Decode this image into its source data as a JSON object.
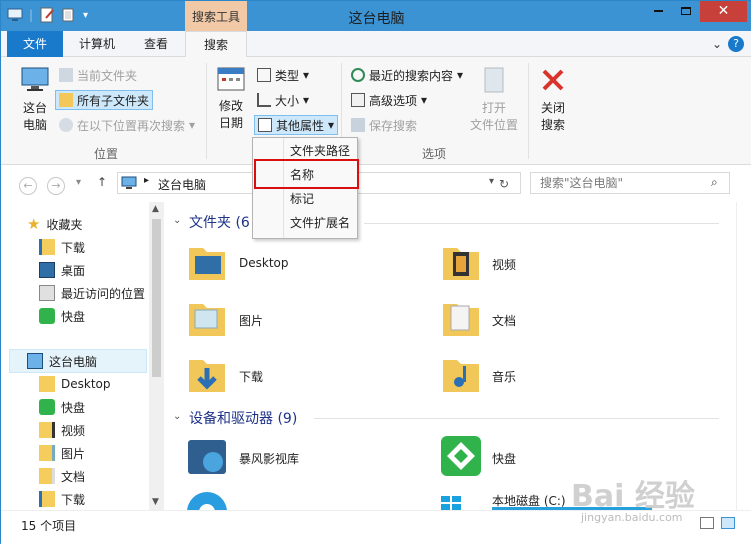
{
  "window": {
    "title": "这台电脑",
    "context_tab": "搜索工具",
    "close_icon": "close-icon"
  },
  "tabs": {
    "file": "文件",
    "computer": "计算机",
    "view": "查看",
    "search": "搜索"
  },
  "ribbon": {
    "this_pc": "这台\n电脑",
    "current_folder": "当前文件夹",
    "all_subfolders": "所有子文件夹",
    "search_again": "在以下位置再次搜索",
    "group_location": "位置",
    "modified_date": "修改\n日期",
    "kind": "类型",
    "size": "大小",
    "other_props": "其他属性",
    "recent_searches": "最近的搜索内容",
    "advanced_options": "高级选项",
    "save_search": "保存搜索",
    "open_location": "打开\n文件位置",
    "group_options": "选项",
    "close_search": "关闭\n搜索"
  },
  "dropdown": {
    "items": [
      "文件夹路径",
      "名称",
      "标记",
      "文件扩展名"
    ]
  },
  "address": {
    "location": "这台电脑",
    "search_placeholder": "搜索\"这台电脑\""
  },
  "sidebar": {
    "favorites": "收藏夹",
    "fav_items": [
      "下载",
      "桌面",
      "最近访问的位置",
      "快盘"
    ],
    "this_pc": "这台电脑",
    "pc_items": [
      "Desktop",
      "快盘",
      "视频",
      "图片",
      "文档",
      "下载"
    ]
  },
  "content": {
    "folders_header": "文件夹 (6",
    "folders": [
      "Desktop",
      "视频",
      "图片",
      "文档",
      "下载",
      "音乐"
    ],
    "devices_header": "设备和驱动器 (9)",
    "devices": [
      "暴风影视库",
      "快盘",
      "本地磁盘 (C:)"
    ]
  },
  "status": {
    "count": "15 个项目"
  },
  "watermark": {
    "brand": "Bai 经验",
    "url": "jingyan.baidu.com"
  }
}
